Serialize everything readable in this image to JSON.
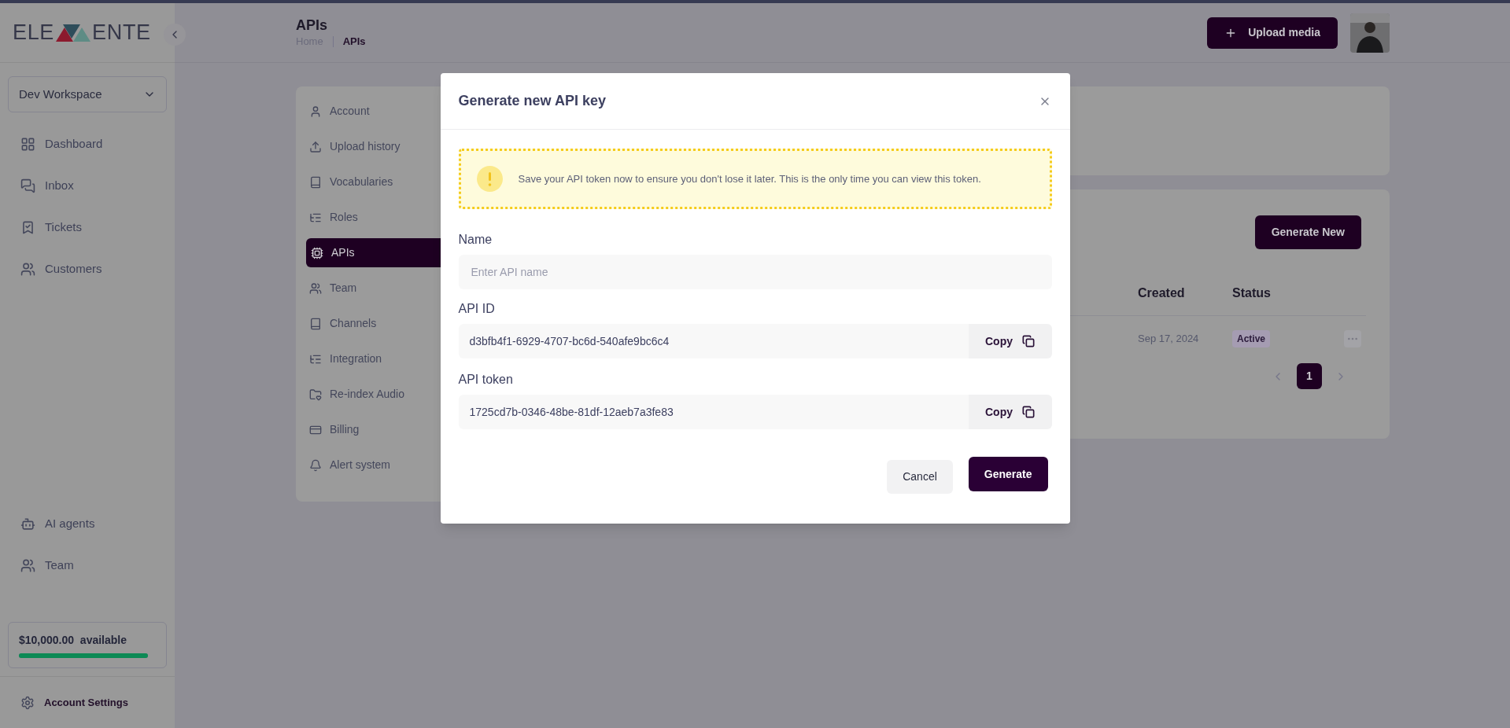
{
  "logo": {
    "left": "ELE",
    "right": "ENTE"
  },
  "workspace": {
    "label": "Dev Workspace"
  },
  "nav": [
    {
      "label": "Dashboard"
    },
    {
      "label": "Inbox"
    },
    {
      "label": "Tickets"
    },
    {
      "label": "Customers"
    }
  ],
  "nav_bottom": [
    {
      "label": "AI agents"
    },
    {
      "label": "Team"
    }
  ],
  "balance": {
    "text": "$10,000.00  available",
    "level": 1
  },
  "account_settings": {
    "label": "Account Settings"
  },
  "header": {
    "title": "APIs",
    "breadcrumbs": [
      {
        "label": "Home",
        "selected": false
      },
      {
        "label": "APIs",
        "selected": true
      }
    ],
    "upload_button": "Upload media"
  },
  "settings_menu": [
    {
      "label": "Account",
      "selected": false
    },
    {
      "label": "Upload history",
      "selected": false
    },
    {
      "label": "Vocabularies",
      "selected": false
    },
    {
      "label": "Roles",
      "selected": false
    },
    {
      "label": "APIs",
      "selected": true
    },
    {
      "label": "Team",
      "selected": false
    },
    {
      "label": "Channels",
      "selected": false
    },
    {
      "label": "Integration",
      "selected": false
    },
    {
      "label": "Re-index Audio",
      "selected": false
    },
    {
      "label": "Billing",
      "selected": false
    },
    {
      "label": "Alert system",
      "selected": false
    }
  ],
  "generate_new": "Generate New",
  "table": {
    "columns": [
      "Created",
      "Status"
    ],
    "rows": [
      {
        "created": "Sep 17, 2024",
        "status": "Active"
      }
    ]
  },
  "pagination": {
    "pages": [
      {
        "label": "1",
        "selected": true
      }
    ]
  },
  "modal": {
    "title": "Generate new API key",
    "notice": "Save your API token now to ensure you don't lose it later. This is the only time you can view this token.",
    "fields": [
      {
        "kind": "input",
        "label": "Name",
        "placeholder": "Enter API name"
      },
      {
        "kind": "copy",
        "label": "API ID",
        "value": "d3bfb4f1-6929-4707-bc6d-540afe9bc6c4",
        "button": "Copy"
      },
      {
        "kind": "copy",
        "label": "API token",
        "value": "1725cd7b-0346-48be-81df-12aeb7a3fe83",
        "button": "Copy"
      }
    ],
    "buttons": [
      {
        "label": "Cancel",
        "kind": "secondary"
      },
      {
        "label": "Generate",
        "kind": "primary"
      }
    ]
  }
}
